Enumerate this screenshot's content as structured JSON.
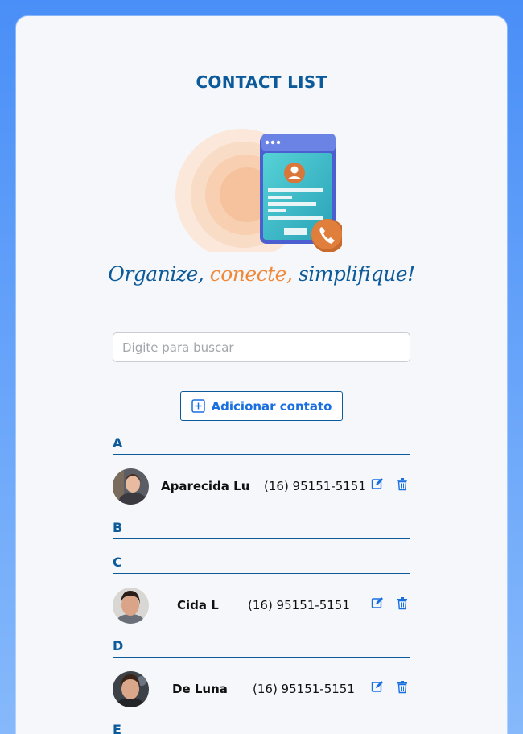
{
  "app": {
    "title": "CONTACT LIST",
    "slogan": {
      "part1": "Organize,",
      "part2": "conecte,",
      "part3": "simplifique!"
    }
  },
  "search": {
    "placeholder": "Digite para buscar",
    "value": ""
  },
  "add_button": {
    "label": "Adicionar contato",
    "icon": "plus-square-icon"
  },
  "groups": [
    {
      "letter": "A",
      "contacts": [
        {
          "name": "Aparecida Lu",
          "phone": "(16) 95151-5151"
        }
      ]
    },
    {
      "letter": "B",
      "contacts": []
    },
    {
      "letter": "C",
      "contacts": [
        {
          "name": "Cida L",
          "phone": "(16) 95151-5151"
        }
      ]
    },
    {
      "letter": "D",
      "contacts": [
        {
          "name": "De Luna",
          "phone": "(16) 95151-5151"
        }
      ]
    },
    {
      "letter": "E",
      "contacts": []
    }
  ],
  "icons": {
    "edit": "edit-icon",
    "delete": "trash-icon"
  },
  "colors": {
    "background": "#4a8ff7",
    "card": "#f5f7fa",
    "primary": "#0d5a9a",
    "accent": "#f0883a",
    "button_text": "#1a6fe0"
  }
}
